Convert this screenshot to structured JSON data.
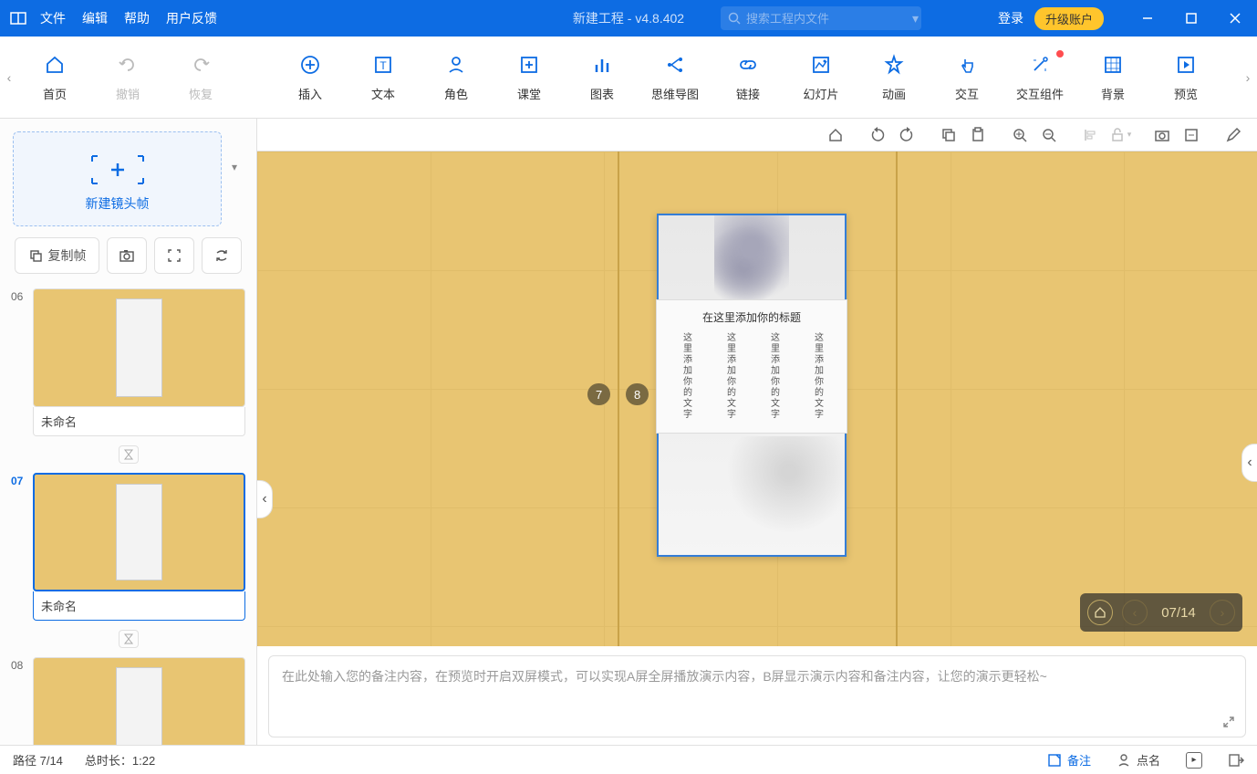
{
  "title": "新建工程 - v4.8.402",
  "menu": {
    "file": "文件",
    "edit": "编辑",
    "help": "帮助",
    "feedback": "用户反馈"
  },
  "search": {
    "placeholder": "搜索工程内文件"
  },
  "login": "登录",
  "upgrade": "升级账户",
  "toolbar": {
    "home": "首页",
    "undo": "撤销",
    "redo": "恢复",
    "insert": "插入",
    "text": "文本",
    "role": "角色",
    "class": "课堂",
    "chart": "图表",
    "mind": "思维导图",
    "link": "链接",
    "slide": "幻灯片",
    "anim": "动画",
    "interact": "交互",
    "component": "交互组件",
    "bg": "背景",
    "preview": "预览"
  },
  "sidebar": {
    "newshot": "新建镜头帧",
    "copy": "复制帧",
    "frames": [
      {
        "num": "06",
        "name": "未命名"
      },
      {
        "num": "07",
        "name": "未命名"
      },
      {
        "num": "08",
        "name": ""
      }
    ]
  },
  "canvas": {
    "markers": {
      "m7": "7",
      "m8": "8"
    },
    "poster": {
      "title": "在这里添加你的标题",
      "col": "这里添加你的文字"
    },
    "nav": {
      "counter": "07/14"
    }
  },
  "notes": {
    "placeholder": "在此处输入您的备注内容，在预览时开启双屏模式，可以实现A屏全屏播放演示内容，B屏显示演示内容和备注内容，让您的演示更轻松~"
  },
  "status": {
    "path": "路径 7/14",
    "duration": "总时长：1:22",
    "remark": "备注",
    "roll": "点名"
  }
}
